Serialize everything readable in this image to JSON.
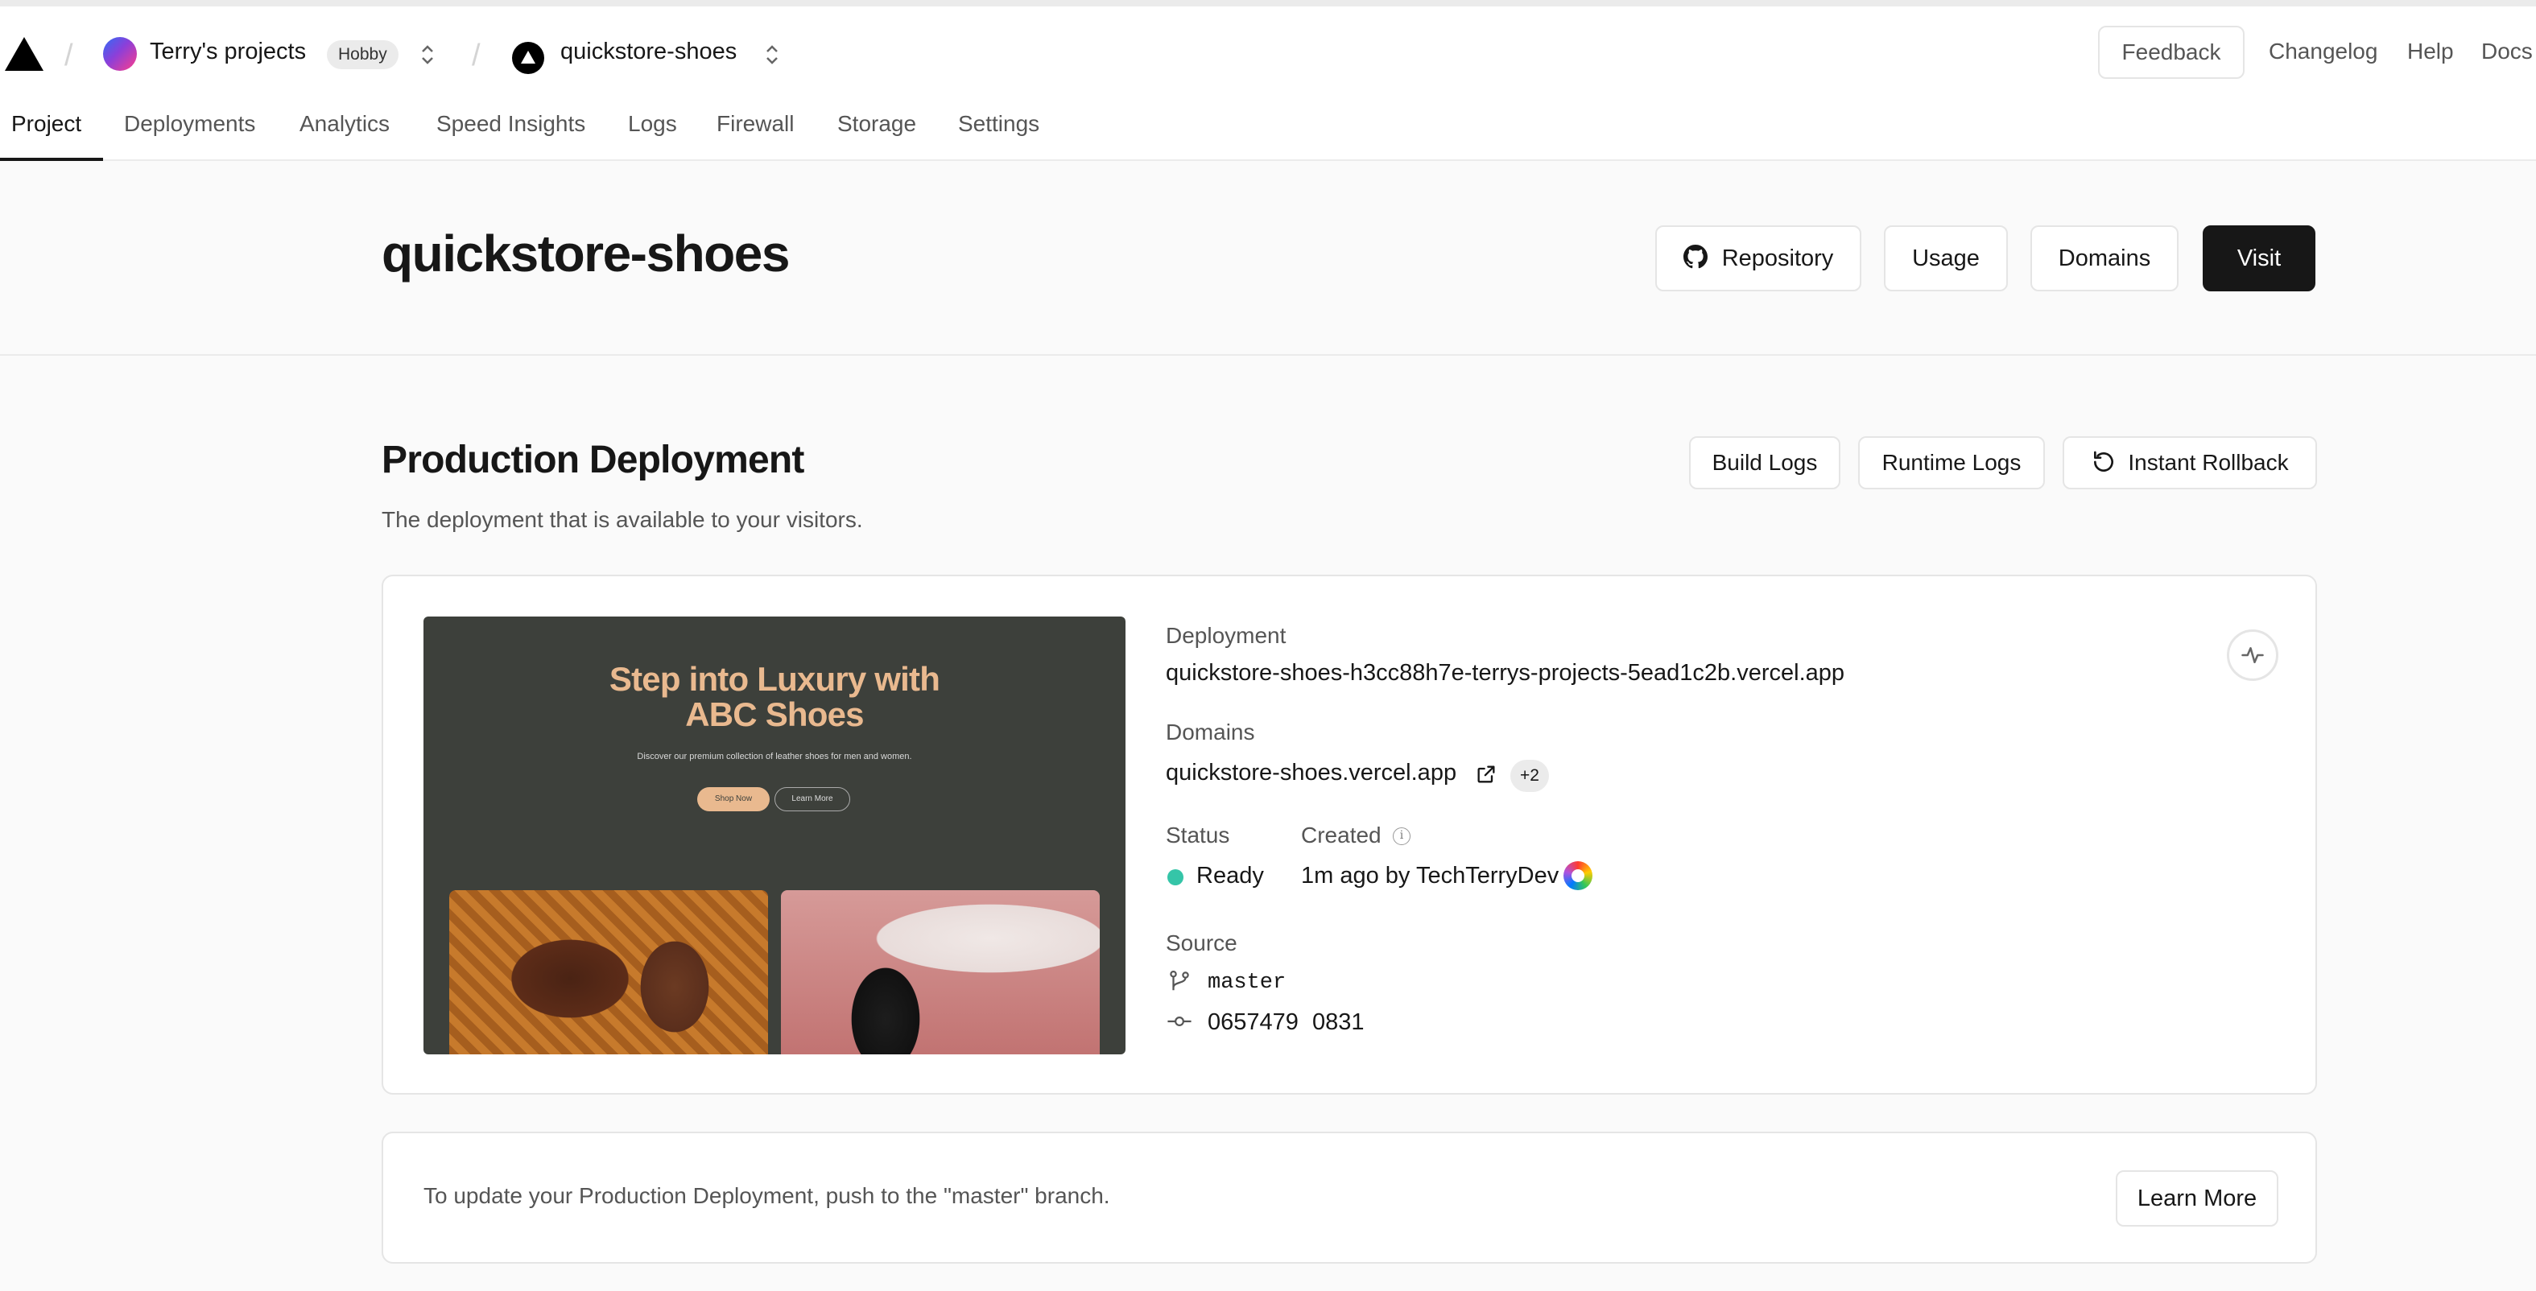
{
  "header": {
    "team_name": "Terry's projects",
    "team_plan": "Hobby",
    "project_name": "quickstore-shoes",
    "feedback_label": "Feedback",
    "changelog_label": "Changelog",
    "help_label": "Help",
    "docs_label": "Docs"
  },
  "tabs": [
    {
      "label": "Project",
      "active": true
    },
    {
      "label": "Deployments"
    },
    {
      "label": "Analytics"
    },
    {
      "label": "Speed Insights"
    },
    {
      "label": "Logs"
    },
    {
      "label": "Firewall"
    },
    {
      "label": "Storage"
    },
    {
      "label": "Settings"
    }
  ],
  "project": {
    "title": "quickstore-shoes",
    "repository_label": "Repository",
    "usage_label": "Usage",
    "domains_label": "Domains",
    "visit_label": "Visit"
  },
  "production": {
    "title": "Production Deployment",
    "subtitle": "The deployment that is available to your visitors.",
    "build_logs_label": "Build Logs",
    "runtime_logs_label": "Runtime Logs",
    "rollback_label": "Instant Rollback",
    "preview": {
      "headline_1": "Step into Luxury with",
      "headline_2": "ABC Shoes",
      "tagline": "Discover our premium collection of leather shoes for men and women.",
      "shop_now": "Shop Now",
      "learn_more": "Learn More"
    },
    "deployment_label": "Deployment",
    "deployment_url": "quickstore-shoes-h3cc88h7e-terrys-projects-5ead1c2b.vercel.app",
    "domains_label": "Domains",
    "domain": "quickstore-shoes.vercel.app",
    "extra_domains": "+2",
    "status_label": "Status",
    "status_value": "Ready",
    "status_color": "#35c5a8",
    "created_label": "Created",
    "created_value": "1m ago by TechTerryDev",
    "source_label": "Source",
    "branch": "master",
    "commit_hash": "0657479",
    "commit_message": "0831"
  },
  "notice": {
    "text": "To update your Production Deployment, push to the \"master\" branch.",
    "button_label": "Learn More"
  }
}
